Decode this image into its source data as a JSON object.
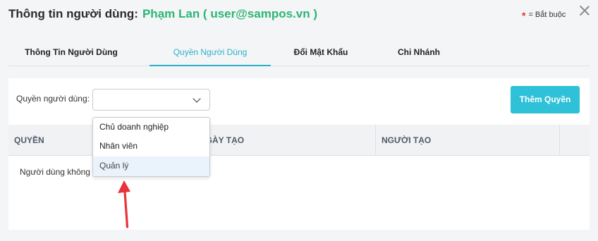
{
  "header": {
    "title": "Thông tin người dùng",
    "colon": ":",
    "user": "Phạm Lan ( user@sampos.vn )",
    "required_star": "*",
    "required_note": "= Bắt buộc"
  },
  "tabs": [
    {
      "label": "Thông Tin Người Dùng",
      "active": false
    },
    {
      "label": "Quyền Người Dùng",
      "active": true
    },
    {
      "label": "Đổi Mật Khẩu",
      "active": false
    },
    {
      "label": "Chi Nhánh",
      "active": false
    }
  ],
  "role_filter": {
    "label": "Quyền người dùng:",
    "value": "",
    "options": [
      "Chủ doanh nghiệp",
      "Nhân viên",
      "Quản lý"
    ],
    "highlighted_option": "Quản lý"
  },
  "add_button": "Thêm Quyền",
  "table": {
    "columns": [
      "QUYỀN",
      "NGÀY TẠO",
      "NGƯỜI TẠO",
      ""
    ],
    "empty_text": "Người dùng không có quyền nào"
  },
  "colors": {
    "accent": "#2bb0c9",
    "user_green": "#2ab673",
    "button": "#2ec1d8",
    "annotation_arrow": "#e8323c"
  }
}
